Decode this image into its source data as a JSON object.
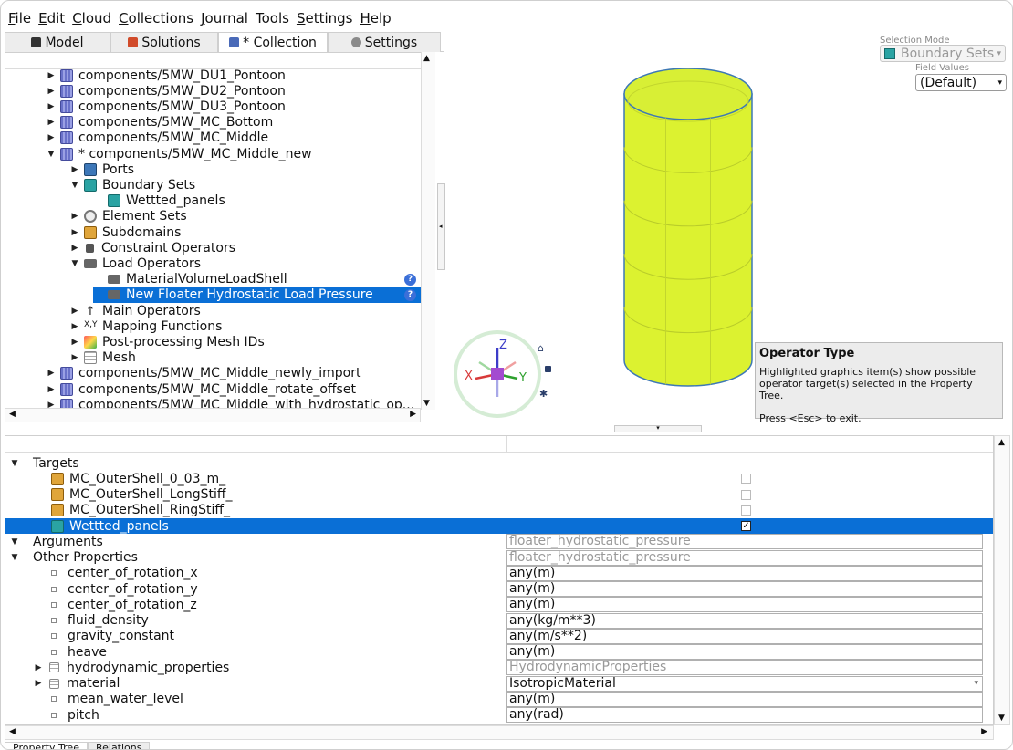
{
  "menu": [
    {
      "label": "File",
      "underline": "F",
      "rest": "ile"
    },
    {
      "label": "Edit",
      "underline": "E",
      "rest": "dit"
    },
    {
      "label": "Cloud",
      "underline": "C",
      "rest": "loud"
    },
    {
      "label": "Collections",
      "underline": "C",
      "rest": "ollections"
    },
    {
      "label": "Journal",
      "underline": "J",
      "rest": "ournal"
    },
    {
      "label": "Tools",
      "underline": "",
      "rest": "Tools"
    },
    {
      "label": "Settings",
      "underline": "S",
      "rest": "ettings"
    },
    {
      "label": "Help",
      "underline": "H",
      "rest": "elp"
    }
  ],
  "tabs": [
    {
      "label": "Model",
      "icon": "model-icon",
      "color": "#333333"
    },
    {
      "label": "Solutions",
      "icon": "solutions-icon",
      "color": "#d14b2a"
    },
    {
      "label": "* Collection",
      "icon": "collection-icon",
      "color": "#4a6ab8"
    },
    {
      "label": "Settings",
      "icon": "gear-icon",
      "color": "#8a8a8a"
    }
  ],
  "tree": [
    {
      "label": "components/5MW_DU1_Pontoon",
      "icon": "component-icon",
      "cls": "ic-comp",
      "level": 0,
      "arrow": "right"
    },
    {
      "label": "components/5MW_DU2_Pontoon",
      "icon": "component-icon",
      "cls": "ic-comp",
      "level": 0,
      "arrow": "right"
    },
    {
      "label": "components/5MW_DU3_Pontoon",
      "icon": "component-icon",
      "cls": "ic-comp",
      "level": 0,
      "arrow": "right"
    },
    {
      "label": "components/5MW_MC_Bottom",
      "icon": "component-icon",
      "cls": "ic-comp",
      "level": 0,
      "arrow": "right"
    },
    {
      "label": "components/5MW_MC_Middle",
      "icon": "component-icon",
      "cls": "ic-comp",
      "level": 0,
      "arrow": "right"
    },
    {
      "label": "* components/5MW_MC_Middle_new",
      "icon": "component-icon",
      "cls": "ic-comp",
      "level": 0,
      "arrow": "down"
    },
    {
      "label": "Ports",
      "icon": "ports-icon",
      "cls": "ic-ports",
      "level": 1,
      "arrow": "right"
    },
    {
      "label": "Boundary Sets",
      "icon": "boundary-set-icon",
      "cls": "ic-bset",
      "level": 1,
      "arrow": "down"
    },
    {
      "label": "Wettted_panels",
      "icon": "boundary-set-icon",
      "cls": "ic-bset",
      "level": 2,
      "arrow": ""
    },
    {
      "label": "Element Sets",
      "icon": "element-set-icon",
      "cls": "ic-eset",
      "level": 1,
      "arrow": "right"
    },
    {
      "label": "Subdomains",
      "icon": "subdomain-icon",
      "cls": "ic-sub",
      "level": 1,
      "arrow": "right"
    },
    {
      "label": "Constraint Operators",
      "icon": "lock-icon",
      "cls": "ic-lock",
      "level": 1,
      "arrow": "right"
    },
    {
      "label": "Load Operators",
      "icon": "factory-icon",
      "cls": "ic-load",
      "level": 1,
      "arrow": "down"
    },
    {
      "label": "MaterialVolumeLoadShell",
      "icon": "factory-icon",
      "cls": "ic-load",
      "level": 2,
      "arrow": "",
      "help": true
    },
    {
      "label": "New Floater Hydrostatic Load Pressure",
      "icon": "factory-icon",
      "cls": "ic-load",
      "level": 2,
      "arrow": "",
      "help": true,
      "selected": true
    },
    {
      "label": "Main Operators",
      "icon": "main-operator-icon",
      "cls": "ic-main",
      "level": 1,
      "arrow": "right",
      "glyph": "↑"
    },
    {
      "label": "Mapping Functions",
      "icon": "mapping-icon",
      "cls": "ic-map",
      "level": 1,
      "arrow": "right",
      "glyph": "X,Y"
    },
    {
      "label": "Post-processing Mesh IDs",
      "icon": "postprocessing-icon",
      "cls": "ic-post",
      "level": 1,
      "arrow": "right"
    },
    {
      "label": "Mesh",
      "icon": "mesh-icon",
      "cls": "ic-mesh",
      "level": 1,
      "arrow": "right"
    },
    {
      "label": "components/5MW_MC_Middle_newly_import",
      "icon": "component-icon",
      "cls": "ic-comp",
      "level": 0,
      "arrow": "right"
    },
    {
      "label": "components/5MW_MC_Middle_rotate_offset",
      "icon": "component-icon",
      "cls": "ic-comp",
      "level": 0,
      "arrow": "right"
    },
    {
      "label": "components/5MW_MC_Middle_with_hydrostatic_op...",
      "icon": "component-icon",
      "cls": "ic-comp",
      "level": 0,
      "arrow": "right"
    }
  ],
  "viewport": {
    "selection_mode_label": "Selection Mode",
    "selection_mode_value": "Boundary Sets",
    "field_values_label": "Field Values",
    "field_values_value": "(Default)",
    "tooltip_title": "Operator Type",
    "tooltip_line1": "Highlighted graphics item(s) show possible operator target(s) selected in the Property Tree.",
    "tooltip_line2": "Press <Esc> to exit.",
    "cylinder_color": "#dcf230",
    "axis_x": "X",
    "axis_y": "Y",
    "axis_z": "Z"
  },
  "props": [
    {
      "label": "Targets",
      "type": "section",
      "arrow": "down",
      "level": 0
    },
    {
      "label": "MC_OuterShell_0_03_m_",
      "type": "target",
      "icon": "subdomain-icon",
      "level": 1,
      "checked": false
    },
    {
      "label": "MC_OuterShell_LongStiff_",
      "type": "target",
      "icon": "subdomain-icon",
      "level": 1,
      "checked": false
    },
    {
      "label": "MC_OuterShell_RingStiff_",
      "type": "target",
      "icon": "subdomain-icon",
      "level": 1,
      "checked": false
    },
    {
      "label": "Wettted_panels",
      "type": "target",
      "icon": "boundary-set-icon",
      "level": 1,
      "checked": true,
      "selected": true
    },
    {
      "label": "Arguments",
      "type": "section",
      "arrow": "down",
      "level": 0,
      "value": "floater_hydrostatic_pressure",
      "grey": true
    },
    {
      "label": "Other Properties",
      "type": "section",
      "arrow": "down",
      "level": 0,
      "value": "floater_hydrostatic_pressure",
      "grey": true
    },
    {
      "label": "center_of_rotation_x",
      "type": "prop",
      "level": 1,
      "value": "any(m)"
    },
    {
      "label": "center_of_rotation_y",
      "type": "prop",
      "level": 1,
      "value": "any(m)"
    },
    {
      "label": "center_of_rotation_z",
      "type": "prop",
      "level": 1,
      "value": "any(m)"
    },
    {
      "label": "fluid_density",
      "type": "prop",
      "level": 1,
      "value": "any(kg/m**3)"
    },
    {
      "label": "gravity_constant",
      "type": "prop",
      "level": 1,
      "value": "any(m/s**2)"
    },
    {
      "label": "heave",
      "type": "prop",
      "level": 1,
      "value": "any(m)"
    },
    {
      "label": "hydrodynamic_properties",
      "type": "group",
      "level": 1,
      "arrow": "right",
      "value": "HydrodynamicProperties",
      "grey": true
    },
    {
      "label": "material",
      "type": "group",
      "level": 1,
      "arrow": "right",
      "value": "IsotropicMaterial",
      "dropdown": true
    },
    {
      "label": "mean_water_level",
      "type": "prop",
      "level": 1,
      "value": "any(m)"
    },
    {
      "label": "pitch",
      "type": "prop",
      "level": 1,
      "value": "any(rad)"
    }
  ],
  "bottom_tabs": [
    {
      "label": "Property Tree"
    },
    {
      "label": "Relations"
    }
  ]
}
